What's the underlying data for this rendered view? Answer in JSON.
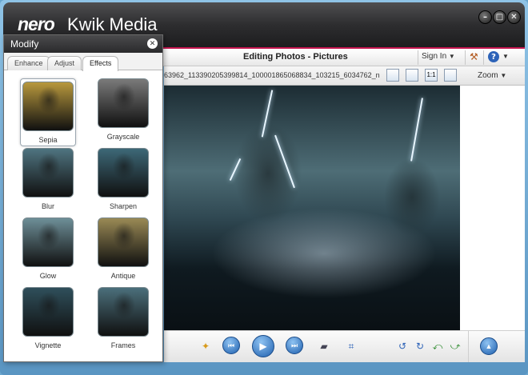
{
  "app": {
    "logo_brand": "nero",
    "logo_name": "Kwik Media"
  },
  "window_controls": [
    "minimize-icon",
    "maximize-icon",
    "close-icon"
  ],
  "toolbar": {
    "title": "Editing Photos - Pictures",
    "signin_label": "Sign In",
    "icons": [
      "hammer-icon",
      "help-icon"
    ]
  },
  "toolbar2": {
    "filename": "63962_113390205399814_100001865068834_103215_6034762_n",
    "zoom_label": "Zoom"
  },
  "modify_panel": {
    "title": "Modify",
    "tabs": [
      {
        "label": "Enhance"
      },
      {
        "label": "Adjust"
      },
      {
        "label": "Effects"
      }
    ],
    "effects": [
      {
        "label": "Sepia",
        "tint": "#b8983d"
      },
      {
        "label": "Grayscale",
        "tint": "#7a7a7a"
      },
      {
        "label": "Blur",
        "tint": "#4f7480"
      },
      {
        "label": "Sharpen",
        "tint": "#3d6877"
      },
      {
        "label": "Glow",
        "tint": "#6e8f98"
      },
      {
        "label": "Antique",
        "tint": "#9a8a55"
      },
      {
        "label": "Vignette",
        "tint": "#2f4f5b"
      },
      {
        "label": "Frames",
        "tint": "#4b6f7b"
      }
    ]
  },
  "colors": {
    "accent": "#c4154e",
    "titlebar": "#2d2d2f",
    "nav_button": "#1e5fae"
  }
}
